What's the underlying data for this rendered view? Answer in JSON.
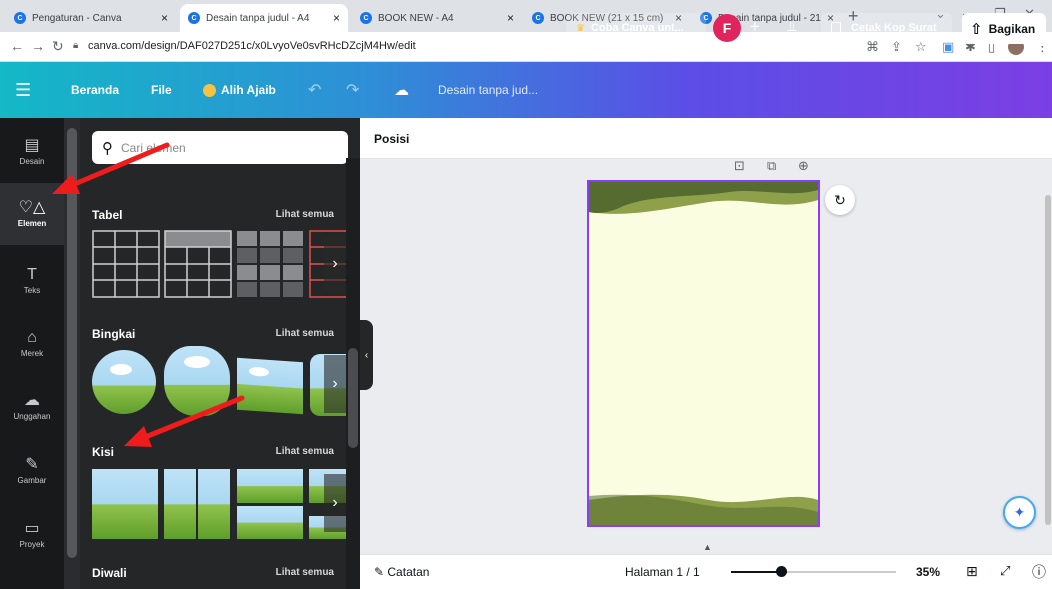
{
  "browser": {
    "tabs": [
      {
        "label": "Pengaturan - Canva"
      },
      {
        "label": "Desain tanpa judul - A4"
      },
      {
        "label": "BOOK NEW - A4"
      },
      {
        "label": "BOOK NEW (21 x 15 cm)"
      },
      {
        "label": "Desain tanpa judul - 21"
      }
    ],
    "close_glyph": "×",
    "new_tab_glyph": "+",
    "url": "canva.com/design/DAF027D251c/x0LvyoVe0svRHcDZcjM4Hw/edit"
  },
  "header": {
    "menu_icon": "☰",
    "beranda": "Beranda",
    "file": "File",
    "alih_ajaib": "Alih Ajaib",
    "doc_title": "Desain tanpa jud...",
    "coba": "Coba Canva unt...",
    "avatar_initial": "F",
    "cetak": "Cetak Kop Surat",
    "bagikan": "Bagikan"
  },
  "rail": {
    "items": [
      {
        "label": "Desain",
        "icon": "▤"
      },
      {
        "label": "Elemen",
        "icon": "♡△"
      },
      {
        "label": "Teks",
        "icon": "T"
      },
      {
        "label": "Merek",
        "icon": "⌂"
      },
      {
        "label": "Unggahan",
        "icon": "☁"
      },
      {
        "label": "Gambar",
        "icon": "✎"
      },
      {
        "label": "Proyek",
        "icon": "▭"
      }
    ]
  },
  "panel": {
    "search_placeholder": "Cari elemen",
    "sections": [
      {
        "title": "Tabel",
        "link": "Lihat semua"
      },
      {
        "title": "Bingkai",
        "link": "Lihat semua"
      },
      {
        "title": "Kisi",
        "link": "Lihat semua"
      },
      {
        "title": "Diwali",
        "link": "Lihat semua"
      }
    ]
  },
  "canvas": {
    "position_label": "Posisi"
  },
  "footer": {
    "notes": "Catatan",
    "page": "Halaman 1 / 1",
    "zoom": "35%",
    "zoom_fraction": 0.35
  },
  "colors": {
    "page_bg": "#fbfde0",
    "wave_dark": "#556b2f",
    "wave_light": "#8ea04a",
    "accent": "#8b3dff",
    "arrow": "#ee1c1c"
  }
}
